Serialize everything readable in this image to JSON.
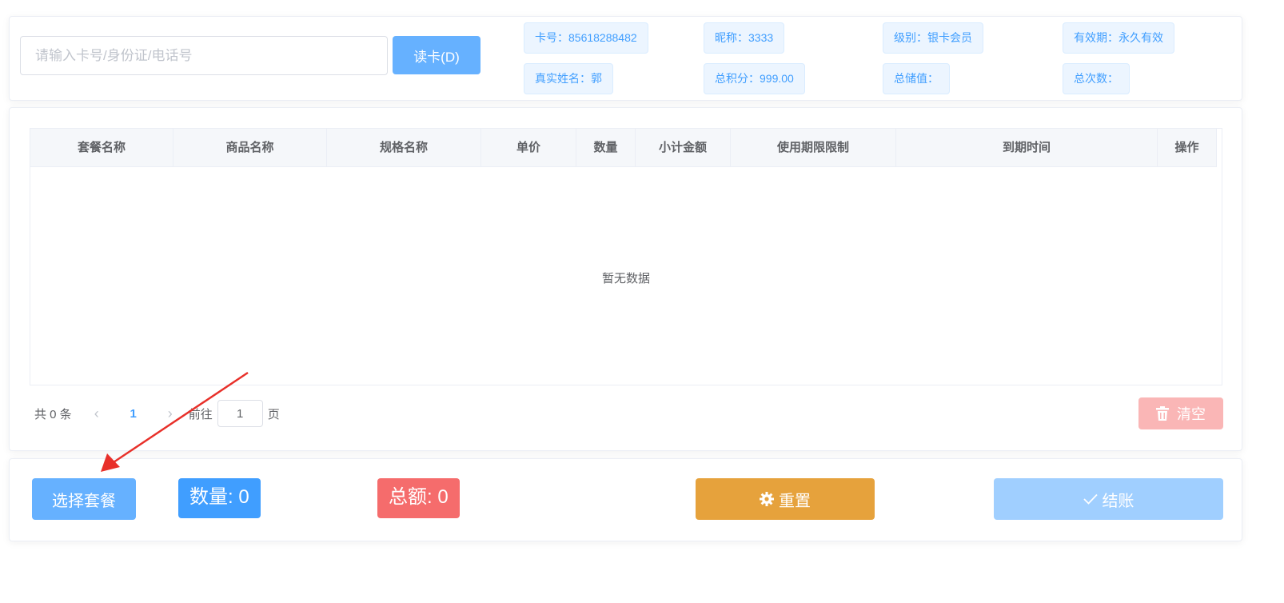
{
  "member": {
    "input_placeholder": "请输入卡号/身份证/电话号",
    "read_button": "读卡(D)",
    "card_no": "卡号：85618288482",
    "nickname": "昵称：3333",
    "level": "级别：银卡会员",
    "validity": "有效期：永久有效",
    "real_name": "真实姓名：郭",
    "total_points": "总积分：999.00",
    "total_stored": "总储值：",
    "total_times": "总次数："
  },
  "table": {
    "columns": [
      "套餐名称",
      "商品名称",
      "规格名称",
      "单价",
      "数量",
      "小计金额",
      "使用期限限制",
      "到期时间",
      "操作"
    ],
    "empty_text": "暂无数据"
  },
  "pager": {
    "total_text": "共 0 条",
    "current_page": "1",
    "goto_label": "前往",
    "goto_value": "1",
    "page_suffix": "页"
  },
  "actions": {
    "clear_label": "清空",
    "choose_label": "选择套餐",
    "qty_text": "数量: 0",
    "amount_text": "总额: 0",
    "reset_label": "重置",
    "checkout_label": "结账"
  },
  "icons": {
    "clear": "trash-icon",
    "reset": "gear-icon",
    "checkout": "check-icon",
    "prev": "chevron-left-icon",
    "next": "chevron-right-icon"
  },
  "colors": {
    "primary": "#409eff",
    "primary_light": "#66b1ff",
    "danger": "#f56c6c",
    "danger_light": "#fab6b6",
    "warning": "#e6a23c",
    "annotation": "#e8302a"
  }
}
